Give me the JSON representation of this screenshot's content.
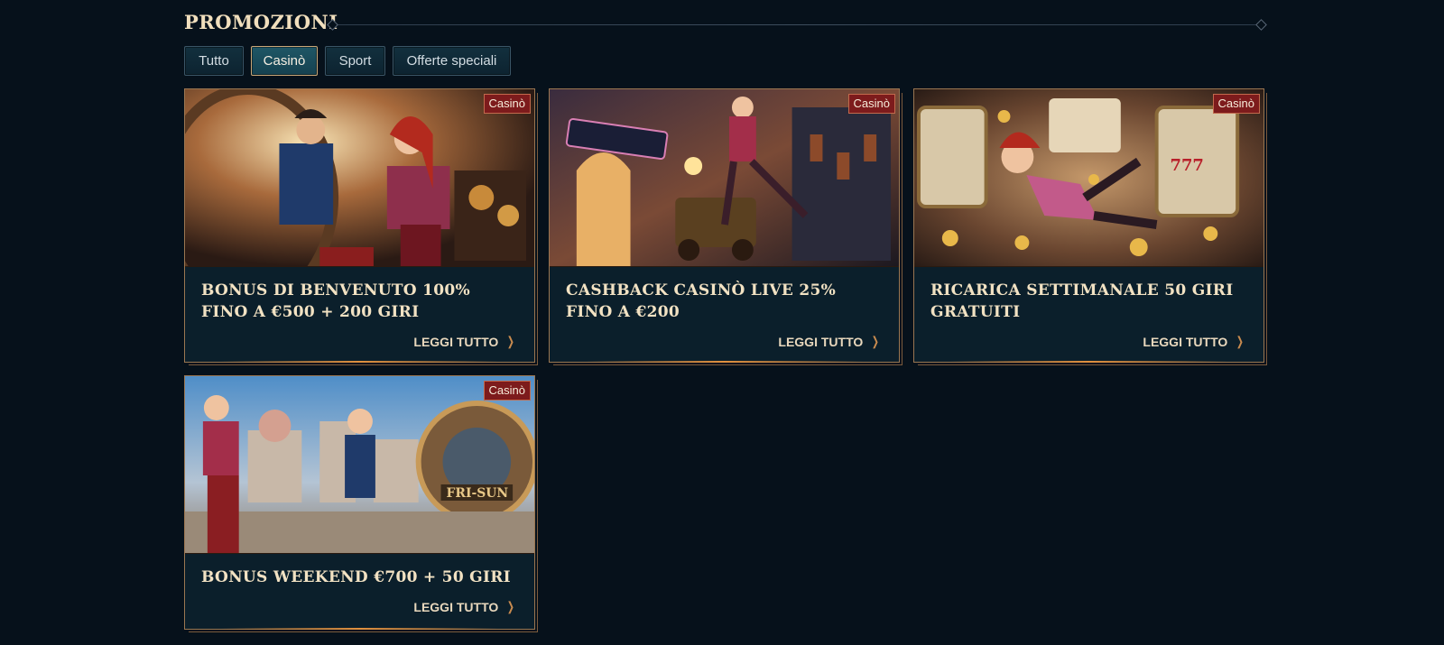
{
  "section": {
    "title": "Promozioni"
  },
  "tabs": [
    {
      "label": "Tutto",
      "active": false
    },
    {
      "label": "Casinò",
      "active": true
    },
    {
      "label": "Sport",
      "active": false
    },
    {
      "label": "Offerte speciali",
      "active": false
    }
  ],
  "promotions": [
    {
      "badge": "Casinò",
      "title": "Bonus di benvenuto 100% fino a €500 + 200 Giri",
      "cta": "LEGGI TUTTO",
      "image": "steampunk-duo-casino-hall"
    },
    {
      "badge": "Casinò",
      "title": "Cashback Casinò Live 25% fino a €200",
      "cta": "LEGGI TUTTO",
      "image": "casino-street-robot"
    },
    {
      "badge": "Casinò",
      "title": "Ricarica settimanale 50 giri gratuiti",
      "cta": "LEGGI TUTTO",
      "image": "slot-machines-coins"
    },
    {
      "badge": "Casinò",
      "title": "Bonus Weekend €700 + 50 giri",
      "cta": "LEGGI TUTTO",
      "image": "fri-sun-wheel-city"
    }
  ],
  "colors": {
    "background": "#06111b",
    "card": "#0b1f2b",
    "accent": "#c9a777",
    "badge": "#7d1b1c"
  },
  "icons": {
    "readmore": "chevron-right-icon"
  }
}
